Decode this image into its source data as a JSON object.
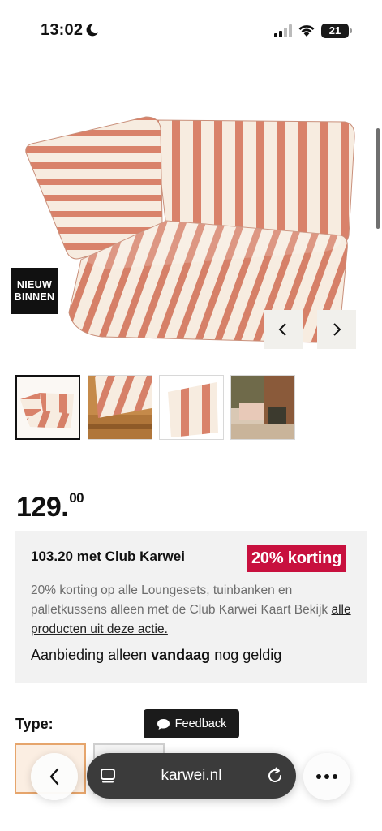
{
  "status_bar": {
    "time": "13:02",
    "battery": "21"
  },
  "gallery": {
    "badge_line1": "NIEUW",
    "badge_line2": "BINNEN"
  },
  "price": {
    "whole": "129.",
    "cents": "00"
  },
  "promo": {
    "title": "103.20 met Club Karwei",
    "badge": "20% korting",
    "text": "20% korting op alle Loungesets, tuinbanken en palletkussens alleen met de Club Karwei Kaart Bekijk",
    "link": "alle producten uit deze actie.",
    "deal_prefix": "Aanbieding alleen",
    "deal_bold": "vandaag",
    "deal_suffix": "nog geldig"
  },
  "type_section": {
    "label": "Type:"
  },
  "feedback": {
    "label": "Feedback"
  },
  "browser": {
    "url": "karwei.nl"
  },
  "colors": {
    "promo_badge": "#c8103e",
    "stripe": "#d9826a",
    "cream": "#f7ece0"
  }
}
